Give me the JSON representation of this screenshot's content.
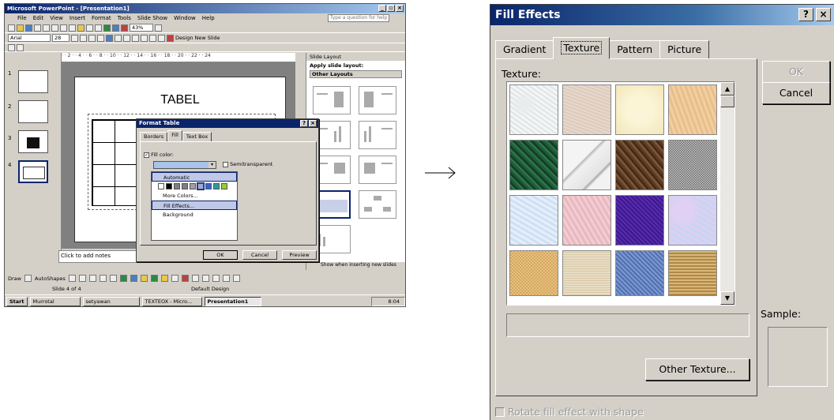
{
  "powerpoint": {
    "title": "Microsoft PowerPoint - [Presentation1]",
    "menu": [
      "File",
      "Edit",
      "View",
      "Insert",
      "Format",
      "Tools",
      "Slide Show",
      "Window",
      "Help"
    ],
    "ask_placeholder": "Type a question for help",
    "font_name": "Arial",
    "font_size": "28",
    "zoom": "43%",
    "design_label": "Design",
    "new_slide_label": "New Slide",
    "slide_title": "TABEL",
    "thumb_numbers": [
      "1",
      "2",
      "3",
      "4"
    ],
    "notes_placeholder": "Click to add notes",
    "task_pane": {
      "header": "Slide Layout",
      "apply_label": "Apply slide layout:",
      "other_layouts": "Other Layouts",
      "footer": "Show when inserting new slides"
    },
    "drawing": {
      "draw_label": "Draw",
      "autoshapes_label": "AutoShapes"
    },
    "status": {
      "slide_of": "Slide 4 of 4",
      "design": "Default Design"
    },
    "taskbar": {
      "start": "Start",
      "buttons": [
        "Murrotal",
        "setyawan",
        "TEXTEOX - Micro...",
        "Presentation1"
      ],
      "clock": "8:04"
    },
    "format_table": {
      "title": "Format Table",
      "tabs": [
        "Borders",
        "Fill",
        "Text Box"
      ],
      "fill_color_label": "Fill color:",
      "semitransparent_label": "Semitransparent",
      "menu_items": [
        "Automatic",
        "More Colors...",
        "Fill Effects...",
        "Background"
      ],
      "swatch_colors": [
        "#ffffff",
        "#000000",
        "#808080",
        "#808080",
        "#a0a0a0",
        "#9aa8e0",
        "#3366cc",
        "#339999",
        "#99cc33"
      ],
      "buttons": {
        "ok": "OK",
        "cancel": "Cancel",
        "preview": "Preview"
      }
    }
  },
  "arrow": "→",
  "fill_effects": {
    "title": "Fill Effects",
    "tabs": [
      "Gradient",
      "Texture",
      "Pattern",
      "Picture"
    ],
    "selected_tab": "Texture",
    "texture_label": "Texture:",
    "textures": [
      "white-marble",
      "sand",
      "parchment",
      "papyrus",
      "green-marble",
      "white-marble-vein",
      "brown-marble",
      "granite",
      "blue-tissue",
      "pink-tissue",
      "purple-mesh",
      "bouquet",
      "cork",
      "canvas",
      "blue-denim",
      "woven-mat"
    ],
    "other_texture_button": "Other Texture...",
    "ok_button": "OK",
    "cancel_button": "Cancel",
    "sample_label": "Sample:",
    "rotate_label": "Rotate fill effect with shape",
    "colors": {
      "titlebar": "#0a246a",
      "dialog_bg": "#d4d0c8"
    }
  }
}
